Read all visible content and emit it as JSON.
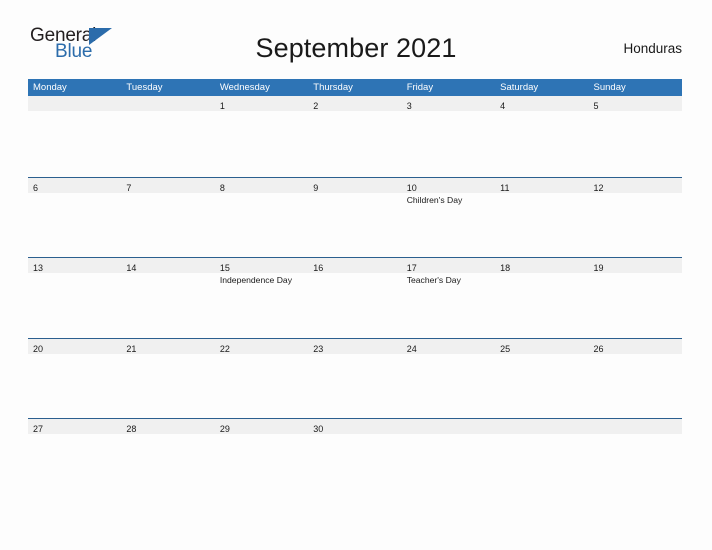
{
  "logo": {
    "word_top": "General",
    "word_bottom": "Blue",
    "flag_icon": "triangle-flag-icon",
    "accent_color": "#2b6cab"
  },
  "header": {
    "title": "September 2021",
    "region": "Honduras"
  },
  "theme": {
    "header_blue": "#2e74b5",
    "row_border_blue": "#2b5f8f",
    "date_band_gray": "#f0f0f0",
    "page_background": "#fdfdfd",
    "text_color": "#1a1a1a"
  },
  "calendar": {
    "weekdays": [
      "Monday",
      "Tuesday",
      "Wednesday",
      "Thursday",
      "Friday",
      "Saturday",
      "Sunday"
    ],
    "weeks": [
      [
        {
          "date": "",
          "event": ""
        },
        {
          "date": "",
          "event": ""
        },
        {
          "date": "1",
          "event": ""
        },
        {
          "date": "2",
          "event": ""
        },
        {
          "date": "3",
          "event": ""
        },
        {
          "date": "4",
          "event": ""
        },
        {
          "date": "5",
          "event": ""
        }
      ],
      [
        {
          "date": "6",
          "event": ""
        },
        {
          "date": "7",
          "event": ""
        },
        {
          "date": "8",
          "event": ""
        },
        {
          "date": "9",
          "event": ""
        },
        {
          "date": "10",
          "event": "Children's Day"
        },
        {
          "date": "11",
          "event": ""
        },
        {
          "date": "12",
          "event": ""
        }
      ],
      [
        {
          "date": "13",
          "event": ""
        },
        {
          "date": "14",
          "event": ""
        },
        {
          "date": "15",
          "event": "Independence Day"
        },
        {
          "date": "16",
          "event": ""
        },
        {
          "date": "17",
          "event": "Teacher's Day"
        },
        {
          "date": "18",
          "event": ""
        },
        {
          "date": "19",
          "event": ""
        }
      ],
      [
        {
          "date": "20",
          "event": ""
        },
        {
          "date": "21",
          "event": ""
        },
        {
          "date": "22",
          "event": ""
        },
        {
          "date": "23",
          "event": ""
        },
        {
          "date": "24",
          "event": ""
        },
        {
          "date": "25",
          "event": ""
        },
        {
          "date": "26",
          "event": ""
        }
      ],
      [
        {
          "date": "27",
          "event": ""
        },
        {
          "date": "28",
          "event": ""
        },
        {
          "date": "29",
          "event": ""
        },
        {
          "date": "30",
          "event": ""
        },
        {
          "date": "",
          "event": ""
        },
        {
          "date": "",
          "event": ""
        },
        {
          "date": "",
          "event": ""
        }
      ]
    ]
  }
}
